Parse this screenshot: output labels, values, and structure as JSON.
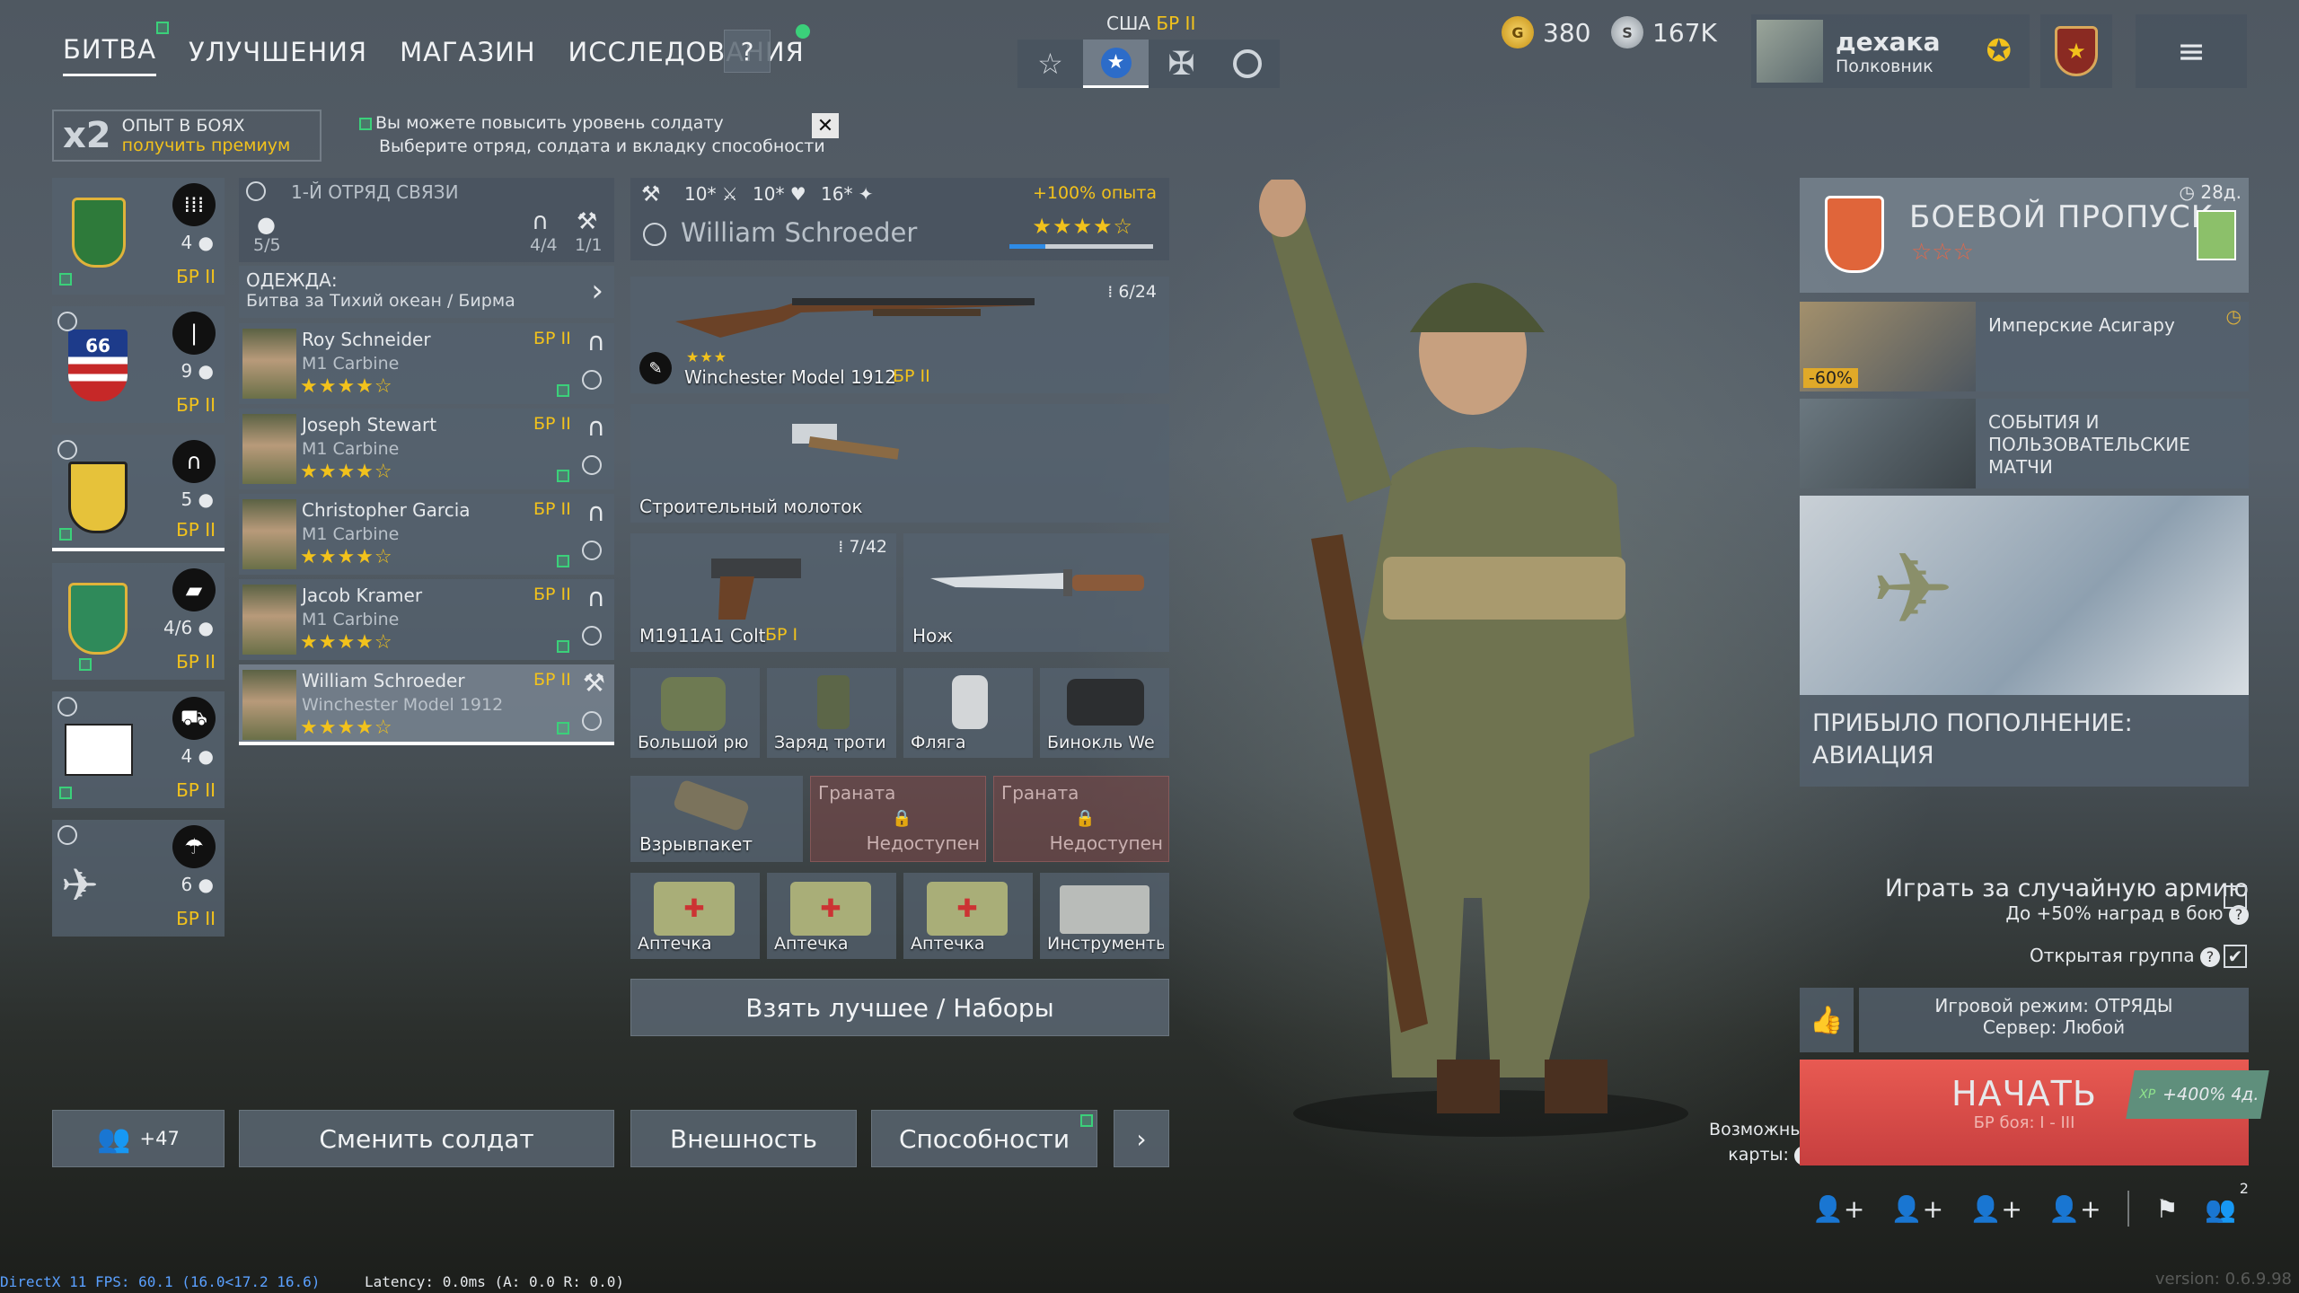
{
  "nav": {
    "tabs": [
      "БИТВА",
      "УЛУЧШЕНИЯ",
      "МАГАЗИН",
      "ИССЛЕДОВАНИЯ"
    ],
    "help": "?"
  },
  "nation": {
    "country": "США",
    "br": "БР II"
  },
  "currency": {
    "gold": "380",
    "silver": "167K"
  },
  "profile": {
    "name": "дехака",
    "rank": "Полковник"
  },
  "exp_bonus": {
    "mult": "x2",
    "title": "ОПЫТ В БОЯХ",
    "premium": "получить премиум"
  },
  "notice": {
    "line1": "Вы можете повысить уровень солдату",
    "line2": "Выберите отряд, солдата и вкладку способности"
  },
  "squads": [
    {
      "count": "4",
      "br": "БР II"
    },
    {
      "count": "9",
      "br": "БР II"
    },
    {
      "count": "5",
      "br": "БР II"
    },
    {
      "count": "4/6",
      "br": "БР II"
    },
    {
      "count": "4",
      "br": "БР II"
    },
    {
      "count": "6",
      "br": "БР II"
    }
  ],
  "squad": {
    "name": "1-Й ОТРЯД СВЯЗИ",
    "size": "5/5",
    "radio": "4/4",
    "eng": "1/1"
  },
  "clothing": {
    "title": "ОДЕЖДА:",
    "value": "Битва за Тихий океан / Бирма"
  },
  "soldiers": [
    {
      "name": "Roy Schneider",
      "weapon": "M1 Carbine",
      "br": "БР II"
    },
    {
      "name": "Joseph Stewart",
      "weapon": "M1 Carbine",
      "br": "БР II"
    },
    {
      "name": "Christopher Garcia",
      "weapon": "M1 Carbine",
      "br": "БР II"
    },
    {
      "name": "Jacob Kramer",
      "weapon": "M1 Carbine",
      "br": "БР II"
    },
    {
      "name": "William Schroeder",
      "weapon": "Winchester Model 1912",
      "br": "БР II"
    }
  ],
  "soldier": {
    "stat1": "10",
    "stat2": "10",
    "stat3": "16",
    "bonus": "+100% опыта",
    "name": "William Schroeder"
  },
  "loadout": {
    "primary": {
      "name": "Winchester Model 1912",
      "br": "БР II",
      "ammo": "6/24"
    },
    "tool": "Строительный молоток",
    "pistol": {
      "name": "M1911A1 Colt",
      "br": "БР I",
      "ammo": "7/42"
    },
    "knife": "Нож",
    "gear": [
      "Большой рю",
      "Заряд троти",
      "Фляга",
      "Бинокль We"
    ],
    "grenade1": "Взрывпакет",
    "locked": [
      {
        "title": "Граната",
        "status": "Недоступен"
      },
      {
        "title": "Граната",
        "status": "Недоступен"
      }
    ],
    "kits": [
      "Аптечка",
      "Аптечка",
      "Аптечка",
      "Инструменты"
    ],
    "best_btn": "Взять лучшее / Наборы"
  },
  "bottom": {
    "invite_count": "+47",
    "change": "Сменить солдат",
    "appearance": "Внешность",
    "abilities": "Способности",
    "maps": "Возможные карты:"
  },
  "battlepass": {
    "days": "28д.",
    "title": "БОЕВОЙ ПРОПУСК"
  },
  "events": [
    {
      "title": "Имперские Асигару",
      "discount": "-60%"
    },
    {
      "title": "СОБЫТИЯ И ПОЛЬЗОВАТЕЛЬСКИЕ МАТЧИ"
    }
  ],
  "banner": "ПРИБЫЛО ПОПОЛНЕНИЕ: АВИАЦИЯ",
  "random_army": {
    "label": "Играть за случайную армию",
    "bonus": "До +50% наград в бою"
  },
  "open_group": "Открытая группа",
  "mode": {
    "line1": "Игровой режим: ОТРЯДЫ",
    "line2": "Сервер: Любой"
  },
  "start": {
    "label": "НАЧАТЬ",
    "br": "БР боя: I - III",
    "boost": "+400% 4д.",
    "xp": "XP"
  },
  "party_count": "2",
  "debug": {
    "fps": "DirectX 11 FPS: 60.1 (16.0<17.2 16.6)",
    "latency": "Latency:  0.0ms (A:  0.0 R:  0.0)",
    "version": "version: 0.6.9.98"
  },
  "colors": {
    "gold": "#f2c21c",
    "start_red": "#d94a4a",
    "green": "#3bd07a"
  }
}
